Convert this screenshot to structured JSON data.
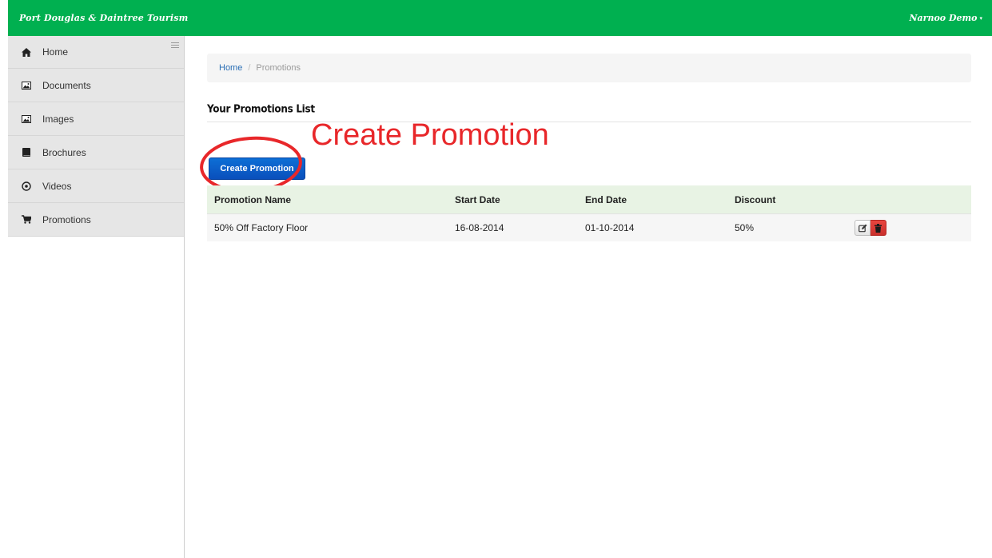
{
  "header": {
    "brand": "Port Douglas & Daintree Tourism",
    "user_menu": "Narnoo Demo",
    "caret": "▾"
  },
  "sidebar": {
    "items": [
      {
        "label": "Home",
        "icon": "home-icon"
      },
      {
        "label": "Documents",
        "icon": "image-icon"
      },
      {
        "label": "Images",
        "icon": "image-icon"
      },
      {
        "label": "Brochures",
        "icon": "book-icon"
      },
      {
        "label": "Videos",
        "icon": "play-circle-icon"
      },
      {
        "label": "Promotions",
        "icon": "cart-icon"
      }
    ]
  },
  "breadcrumb": {
    "home": "Home",
    "separator": "/",
    "current": "Promotions"
  },
  "main": {
    "title": "Your Promotions List",
    "annotation": "Create Promotion",
    "create_button": "Create Promotion"
  },
  "table": {
    "headers": [
      "Promotion Name",
      "Start Date",
      "End Date",
      "Discount"
    ],
    "rows": [
      {
        "name": "50% Off Factory Floor",
        "start": "16-08-2014",
        "end": "01-10-2014",
        "discount": "50%"
      }
    ]
  },
  "colors": {
    "header_bg": "#00b050",
    "primary_button": "#0a5fc9",
    "danger": "#d9342e",
    "annotation": "#e8272a",
    "table_header_bg": "#e8f3e4"
  }
}
